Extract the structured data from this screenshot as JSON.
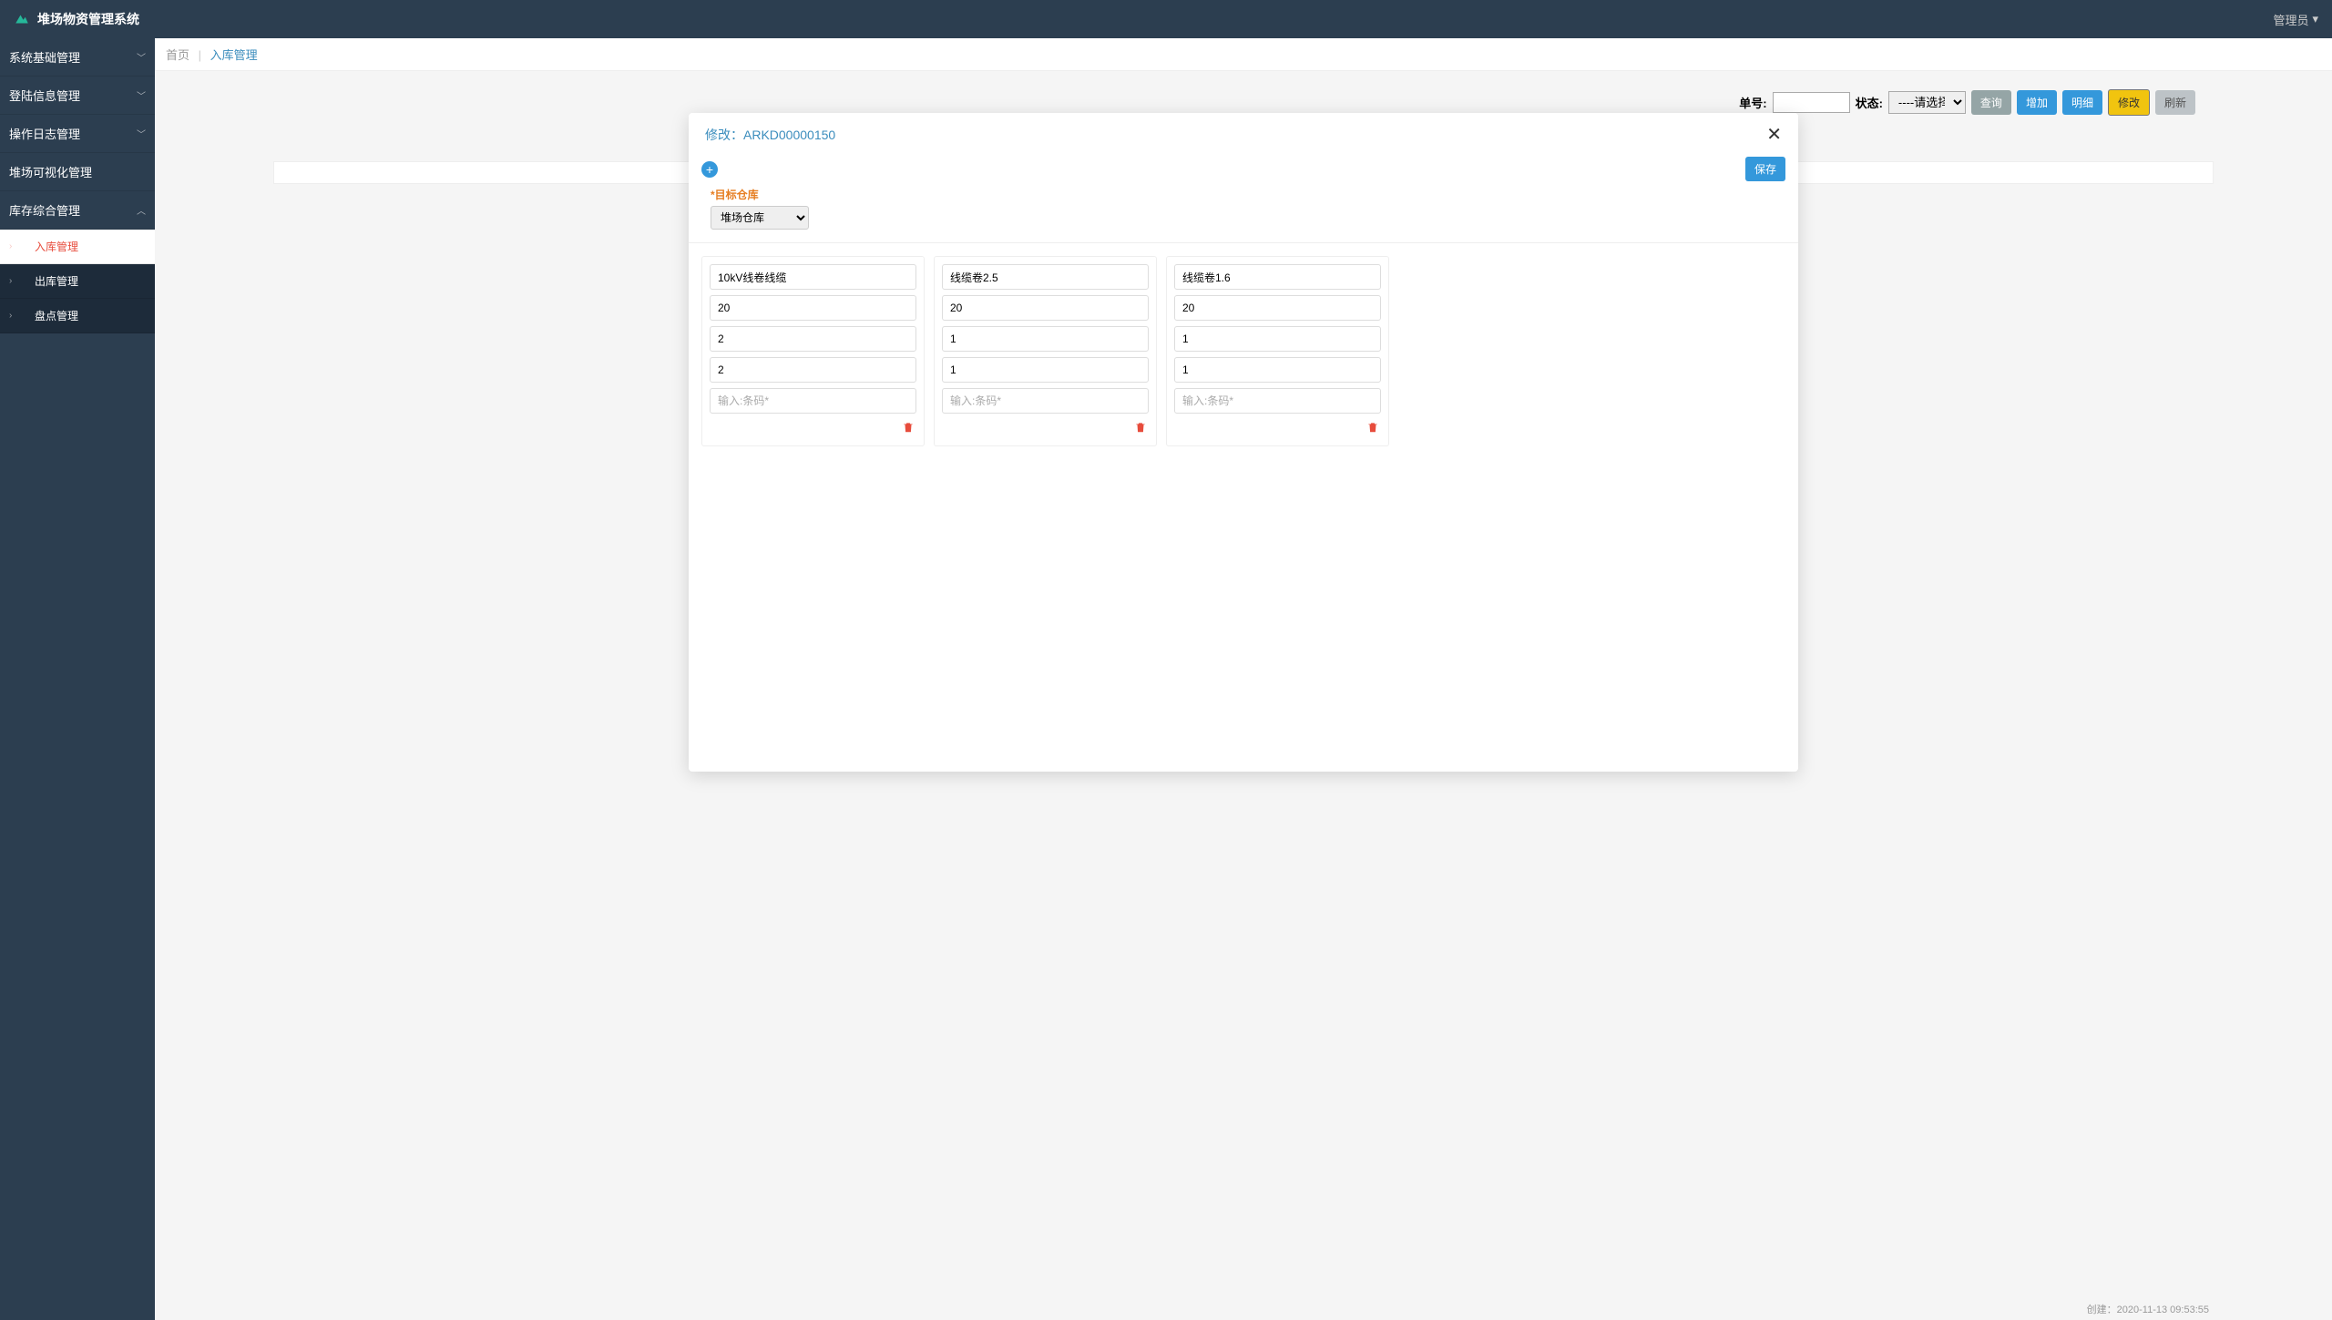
{
  "app": {
    "title": "堆场物资管理系统"
  },
  "header": {
    "user": "管理员"
  },
  "sidebar": {
    "items": [
      {
        "label": "系统基础管理",
        "expand": "down"
      },
      {
        "label": "登陆信息管理",
        "expand": "down"
      },
      {
        "label": "操作日志管理",
        "expand": "down"
      },
      {
        "label": "堆场可视化管理",
        "expand": "none"
      },
      {
        "label": "库存综合管理",
        "expand": "up"
      }
    ],
    "sub": [
      {
        "label": "入库管理",
        "active": true
      },
      {
        "label": "出库管理",
        "active": false
      },
      {
        "label": "盘点管理",
        "active": false
      }
    ]
  },
  "breadcrumb": {
    "home": "首页",
    "current": "入库管理"
  },
  "toolbar": {
    "order_label": "单号:",
    "order_value": "",
    "status_label": "状态:",
    "status_placeholder": "----请选择----",
    "query": "查询",
    "add": "增加",
    "detail": "明细",
    "edit": "修改",
    "refresh": "刷新"
  },
  "modal": {
    "title_prefix": "修改：",
    "title_id": "ARKD00000150",
    "save": "保存",
    "target_label": "*目标仓库",
    "target_value": "堆场仓库",
    "barcode_placeholder": "输入:条码*",
    "cards": [
      {
        "name": "10kV线卷线缆",
        "f2": "20",
        "f3": "2",
        "f4": "2"
      },
      {
        "name": "线缆卷2.5",
        "f2": "20",
        "f3": "1",
        "f4": "1"
      },
      {
        "name": "线缆卷1.6",
        "f2": "20",
        "f3": "1",
        "f4": "1"
      }
    ]
  },
  "footer": {
    "created": "创建：2020-11-13 09:53:55"
  }
}
